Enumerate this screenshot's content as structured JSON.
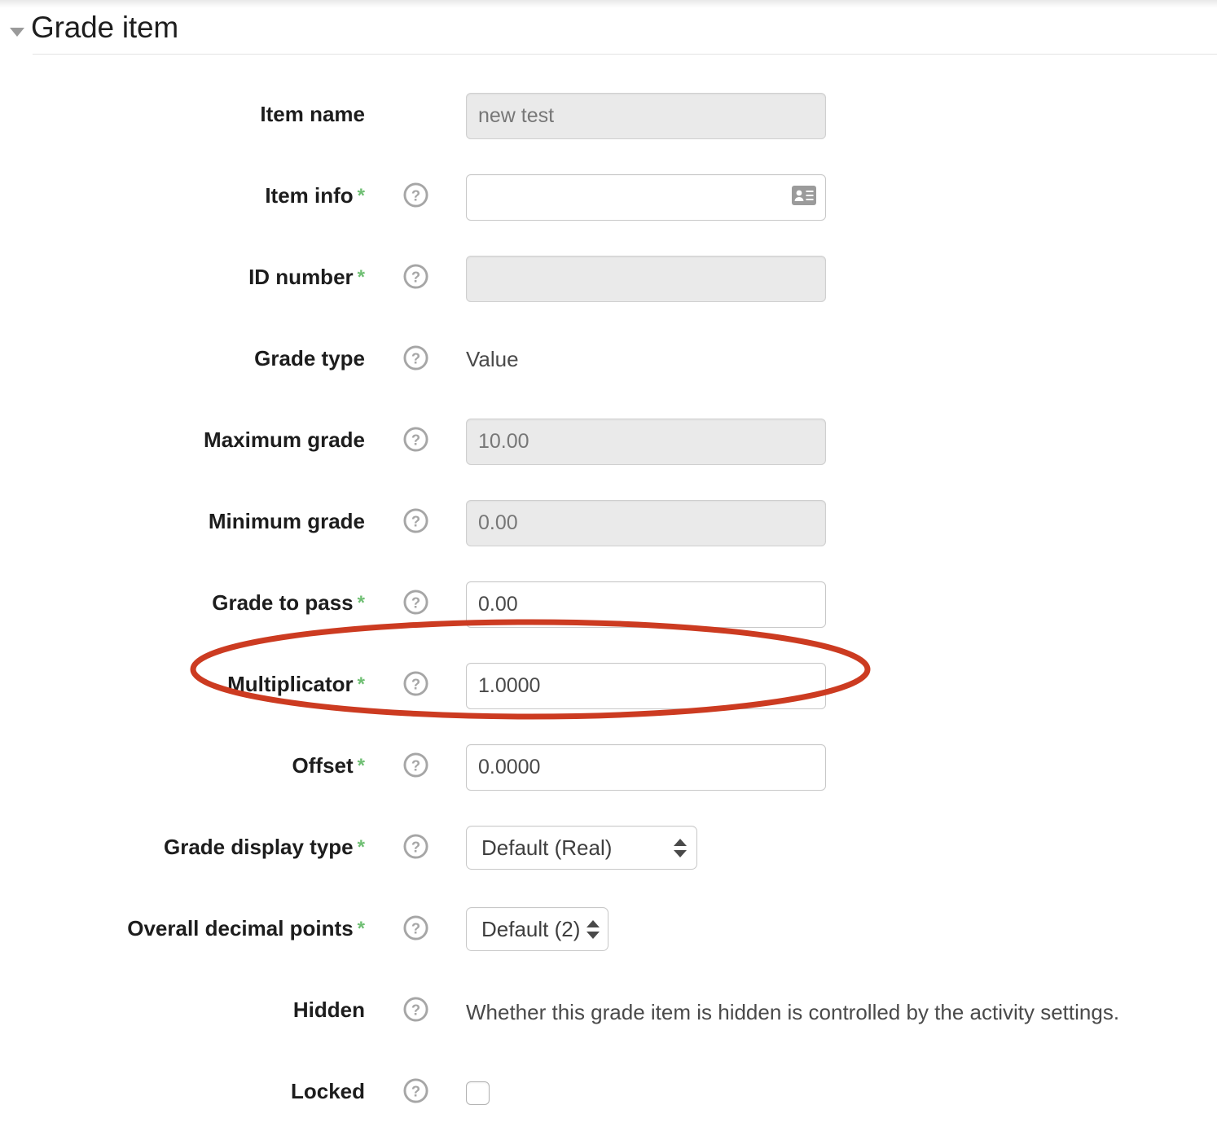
{
  "section": {
    "title": "Grade item",
    "collapse_icon": "caret-down-icon"
  },
  "required_marker": "*",
  "help_icon_label": "?",
  "annotation": {
    "shape": "ellipse",
    "color": "#cc3b21",
    "target": "Multiplicator"
  },
  "fields": {
    "item_name": {
      "label": "Item name",
      "value": "new test",
      "placeholder": "",
      "disabled": true,
      "required": false,
      "has_help": false
    },
    "item_info": {
      "label": "Item info",
      "value": "",
      "placeholder": "",
      "disabled": false,
      "required": true,
      "has_help": true,
      "inline_icon": "contact-card-icon"
    },
    "id_number": {
      "label": "ID number",
      "value": "",
      "placeholder": "",
      "disabled": true,
      "required": true,
      "has_help": true
    },
    "grade_type": {
      "label": "Grade type",
      "value": "Value",
      "required": false,
      "has_help": true
    },
    "maximum_grade": {
      "label": "Maximum grade",
      "value": "10.00",
      "disabled": true,
      "required": false,
      "has_help": true
    },
    "minimum_grade": {
      "label": "Minimum grade",
      "value": "0.00",
      "disabled": true,
      "required": false,
      "has_help": true
    },
    "grade_to_pass": {
      "label": "Grade to pass",
      "value": "0.00",
      "disabled": false,
      "required": true,
      "has_help": true
    },
    "multiplicator": {
      "label": "Multiplicator",
      "value": "1.0000",
      "disabled": false,
      "required": true,
      "has_help": true
    },
    "offset": {
      "label": "Offset",
      "value": "0.0000",
      "disabled": false,
      "required": true,
      "has_help": true
    },
    "grade_display_type": {
      "label": "Grade display type",
      "value": "Default (Real)",
      "required": true,
      "has_help": true
    },
    "overall_decimal_points": {
      "label": "Overall decimal points",
      "value": "Default (2)",
      "required": true,
      "has_help": true
    },
    "hidden": {
      "label": "Hidden",
      "note": "Whether this grade item is hidden is controlled by the activity settings.",
      "required": false,
      "has_help": true
    },
    "locked": {
      "label": "Locked",
      "checked": false,
      "required": false,
      "has_help": true
    }
  }
}
